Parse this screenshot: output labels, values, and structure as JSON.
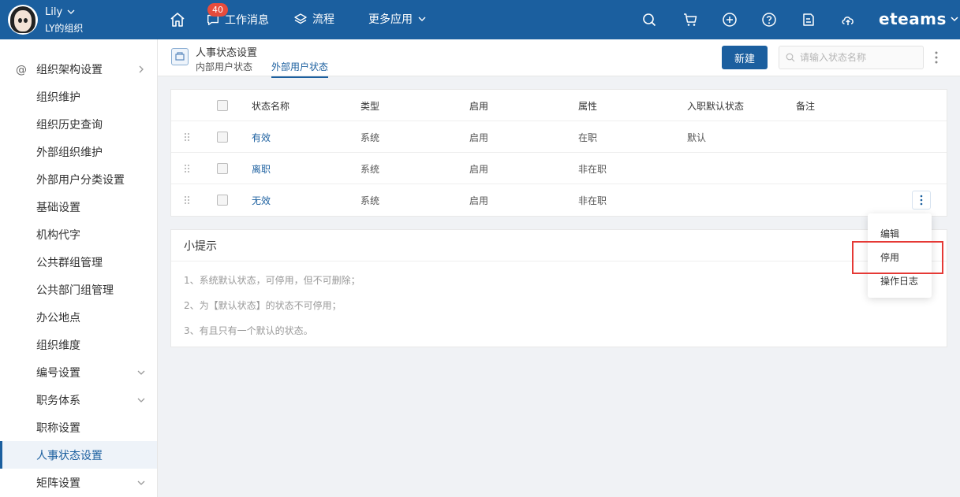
{
  "topbar": {
    "user_name": "Lily",
    "user_org": "LY的组织",
    "badge_count": "40",
    "nav": {
      "messages": "工作消息",
      "flow": "流程",
      "more_apps": "更多应用"
    },
    "brand": "eteams",
    "icons": [
      "home-icon",
      "chat-bubble-icon",
      "layers-icon",
      "chevron-down-icon",
      "search-icon",
      "cart-icon",
      "plus-circle-icon",
      "help-icon",
      "note-icon",
      "cloud-upload-icon"
    ]
  },
  "sidebar": {
    "items": [
      {
        "label": "组织架构设置",
        "arrow": "right"
      },
      {
        "label": "组织维护"
      },
      {
        "label": "组织历史查询"
      },
      {
        "label": "外部组织维护"
      },
      {
        "label": "外部用户分类设置"
      },
      {
        "label": "基础设置"
      },
      {
        "label": "机构代字"
      },
      {
        "label": "公共群组管理"
      },
      {
        "label": "公共部门组管理"
      },
      {
        "label": "办公地点"
      },
      {
        "label": "组织维度"
      },
      {
        "label": "编号设置",
        "arrow": "down"
      },
      {
        "label": "职务体系",
        "arrow": "down"
      },
      {
        "label": "职称设置"
      },
      {
        "label": "人事状态设置",
        "active": true
      },
      {
        "label": "矩阵设置",
        "arrow": "down"
      }
    ]
  },
  "page": {
    "title": "人事状态设置",
    "tabs": [
      {
        "label": "内部用户状态",
        "active": false
      },
      {
        "label": "外部用户状态",
        "active": true
      }
    ],
    "new_button": "新建",
    "search_placeholder": "请输入状态名称"
  },
  "table": {
    "columns": [
      "状态名称",
      "类型",
      "启用",
      "属性",
      "入职默认状态",
      "备注"
    ],
    "rows": [
      {
        "name": "有效",
        "type": "系统",
        "enabled": "启用",
        "attr": "在职",
        "default": "默认",
        "note": ""
      },
      {
        "name": "离职",
        "type": "系统",
        "enabled": "启用",
        "attr": "非在职",
        "default": "",
        "note": ""
      },
      {
        "name": "无效",
        "type": "系统",
        "enabled": "启用",
        "attr": "非在职",
        "default": "",
        "note": ""
      }
    ]
  },
  "tips": {
    "title": "小提示",
    "items": [
      "1、系统默认状态，可停用，但不可删除；",
      "2、为【默认状态】的状态不可停用；",
      "3、有且只有一个默认的状态。"
    ]
  },
  "dropdown": {
    "items": [
      "编辑",
      "停用",
      "操作日志"
    ]
  },
  "colors": {
    "primary": "#1b5f9f",
    "highlight": "#e53935",
    "badge": "#e74c3c"
  }
}
